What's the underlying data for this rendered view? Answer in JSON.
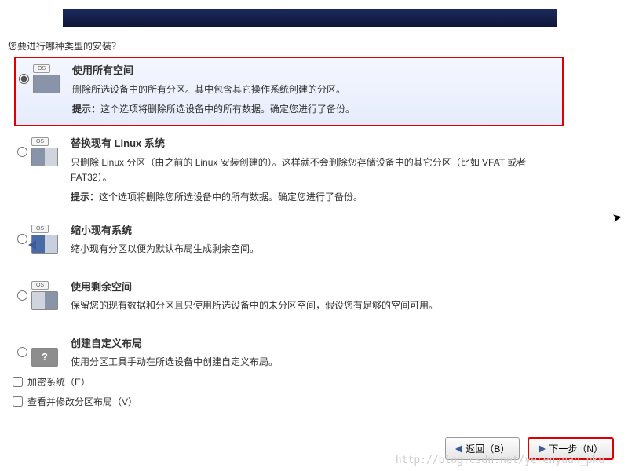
{
  "prompt": "您要进行哪种类型的安装？",
  "options": [
    {
      "title": "使用所有空间",
      "desc": "删除所选设备中的所有分区。其中包含其它操作系统创建的分区。",
      "tip_label": "提示：",
      "tip_text": "这个选项将删除所选设备中的所有数据。确定您进行了备份。"
    },
    {
      "title": "替换现有 Linux 系统",
      "desc": "只删除 Linux 分区（由之前的 Linux 安装创建的）。这样就不会删除您存储设备中的其它分区（比如 VFAT 或者 FAT32）。",
      "tip_label": "提示：",
      "tip_text": "这个选项将删除您所选设备中的所有数据。确定您进行了备份。"
    },
    {
      "title": "缩小现有系统",
      "desc": "缩小现有分区以便为默认布局生成剩余空间。"
    },
    {
      "title": "使用剩余空间",
      "desc": "保留您的现有数据和分区且只使用所选设备中的未分区空间，假设您有足够的空间可用。"
    },
    {
      "title": "创建自定义布局",
      "desc": "使用分区工具手动在所选设备中创建自定义布局。"
    }
  ],
  "checkboxes": {
    "encrypt": "加密系统（E）",
    "review": "查看并修改分区布局（V）"
  },
  "buttons": {
    "back": "返回（B）",
    "next": "下一步（N）"
  },
  "watermark": "http://blog.csdn.net/yerenyuan_pku"
}
